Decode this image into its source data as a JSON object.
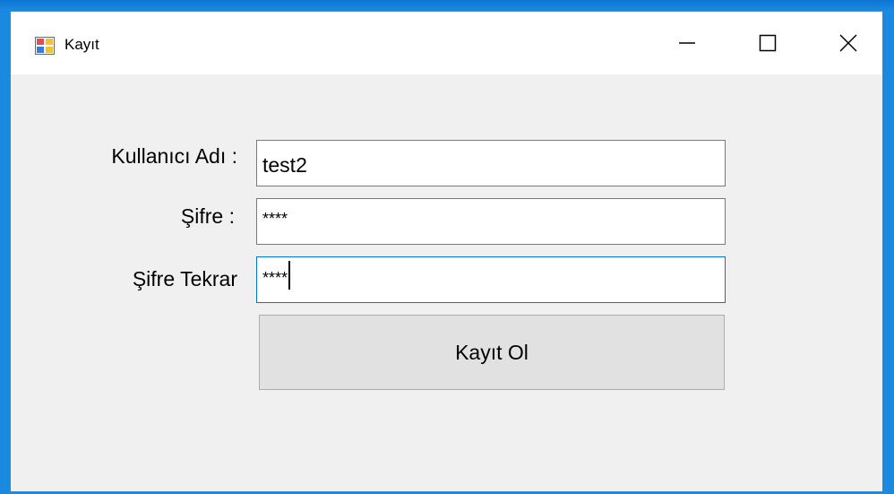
{
  "window": {
    "title": "Kayıt",
    "icon": "winforms-app-icon"
  },
  "titlebar_controls": {
    "minimize": "minimize-icon",
    "maximize": "maximize-icon",
    "close": "close-icon"
  },
  "form": {
    "username_label": "Kullanıcı Adı :",
    "username_value": "test2",
    "password_label": "Şifre :",
    "password_value": "****",
    "password_repeat_label": "Şifre Tekrar",
    "password_repeat_value": "****",
    "submit_label": "Kayıt Ol"
  },
  "colors": {
    "desktop": "#1a8ae0",
    "window_bg": "#f0f0f0",
    "focus_border": "#0078d7",
    "button_bg": "#e1e1e1"
  }
}
